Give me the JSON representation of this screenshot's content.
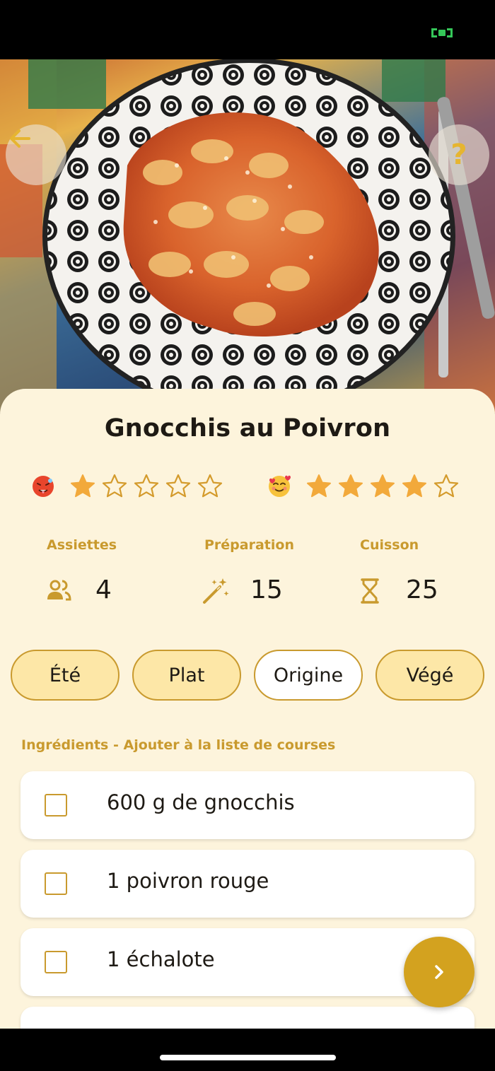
{
  "recipe": {
    "title": "Gnocchis au Poivron",
    "ratings": {
      "spicy": {
        "icon": "hot-face-emoji",
        "value": 1,
        "max": 5
      },
      "liked": {
        "icon": "smiling-face-with-hearts-emoji",
        "value": 4,
        "max": 5
      }
    },
    "info": {
      "servings": {
        "label": "Assiettes",
        "value": "4",
        "icon": "people-icon"
      },
      "preparation": {
        "label": "Préparation",
        "value": "15",
        "icon": "magic-wand-icon"
      },
      "cooking": {
        "label": "Cuisson",
        "value": "25",
        "icon": "hourglass-icon"
      }
    },
    "tags": [
      {
        "label": "Été",
        "selected": true
      },
      {
        "label": "Plat",
        "selected": true
      },
      {
        "label": "Origine",
        "selected": false
      },
      {
        "label": "Végé",
        "selected": true
      }
    ],
    "ingredients_title": "Ingrédients - Ajouter à la liste de courses",
    "ingredients": [
      {
        "text": "600 g de gnocchis",
        "checked": false
      },
      {
        "text": "1 poivron rouge",
        "checked": false
      },
      {
        "text": "1 échalote",
        "checked": false
      }
    ]
  },
  "nav": {
    "back_icon": "arrow-left-icon",
    "help_icon": "question-mark-icon",
    "help_label": "?",
    "next_icon": "chevron-right-icon"
  },
  "colors": {
    "accent": "#d3a21f",
    "label": "#c99a2e",
    "card_background": "#fdf4dc",
    "tag_fill": "#fde7a7",
    "star": "#f2a93b",
    "battery": "#35c759"
  }
}
